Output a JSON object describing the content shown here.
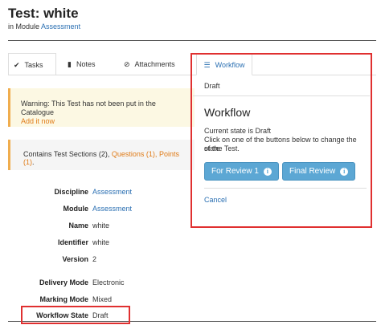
{
  "header": {
    "title": "Test: white",
    "module_prefix": "in Module",
    "module_link": "Assessment"
  },
  "tabs": [
    {
      "label": "Tasks",
      "icon": "check-icon"
    },
    {
      "label": "Notes",
      "icon": "document-icon"
    },
    {
      "label": "Attachments",
      "icon": "paperclip-icon"
    },
    {
      "label": "Workflow",
      "icon": "list-icon"
    }
  ],
  "warning": {
    "text": "Warning: This Test has not been put in the Catalogue",
    "link": "Add it now"
  },
  "contains": {
    "prefix": "Contains Test Sections (2),",
    "questions": "Questions (1),",
    "points": "Points (1)",
    "suffix": "."
  },
  "properties": [
    {
      "label": "Discipline",
      "value": "Assessment",
      "link": true
    },
    {
      "label": "Module",
      "value": "Assessment",
      "link": true
    },
    {
      "label": "Name",
      "value": "white",
      "link": false
    },
    {
      "label": "Identifier",
      "value": "white",
      "link": false
    },
    {
      "label": "Version",
      "value": "2",
      "link": false
    },
    {
      "label": "Delivery Mode",
      "value": "Electronic",
      "link": false
    },
    {
      "label": "Marking Mode",
      "value": "Mixed",
      "link": false
    },
    {
      "label": "Workflow State",
      "value": "Draft",
      "link": false
    }
  ],
  "workflow_panel": {
    "state_header": "Draft",
    "title": "Workflow",
    "line1": "Current state is Draft",
    "line2": "Click on one of the buttons below to change the state",
    "line3": "of the Test.",
    "button_review": "For Review 1",
    "button_final": "Final Review",
    "cancel": "Cancel"
  },
  "colors": {
    "link": "#2a6fb2",
    "button": "#5ca7d4",
    "warning_border": "#f0ad4e",
    "highlight": "#e03030"
  }
}
